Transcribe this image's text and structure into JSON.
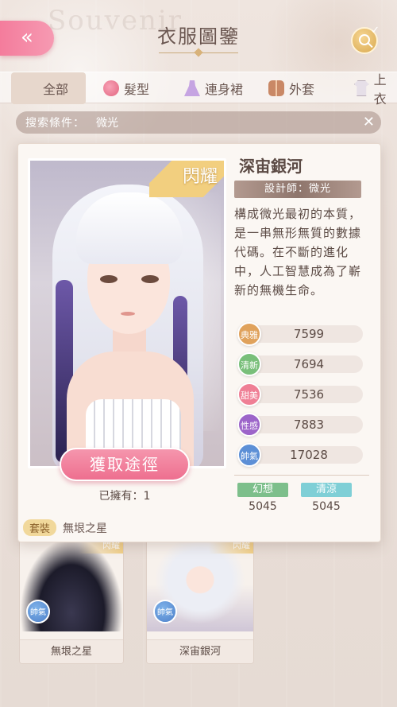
{
  "header": {
    "title": "衣服圖鑒",
    "back_icon": "«",
    "bg_text": "Souvenir"
  },
  "tabs": [
    {
      "label": "全部",
      "icon": "grid-icon",
      "active": true
    },
    {
      "label": "髮型",
      "icon": "hair-icon"
    },
    {
      "label": "連身裙",
      "icon": "dress-icon"
    },
    {
      "label": "外套",
      "icon": "coat-icon"
    },
    {
      "label": "上衣",
      "icon": "top-icon"
    }
  ],
  "filter": {
    "label": "搜索條件：",
    "value": "微光",
    "clear": "✕"
  },
  "detail": {
    "badge": "閃耀",
    "name": "深宙銀河",
    "designer": "設計師：微光",
    "description": "構成微光最初的本質，是一串無形無質的數據代碼。在不斷的進化中，人工智慧成為了嶄新的無機生命。",
    "obtain_button": "獲取途徑",
    "owned": "已擁有：1",
    "set_tag": "套裝",
    "set_name": "無垠之星",
    "stats": [
      {
        "label": "典雅",
        "value": "7599",
        "color": "#e0a25c"
      },
      {
        "label": "清新",
        "value": "7694",
        "color": "#79bf7a"
      },
      {
        "label": "甜美",
        "value": "7536",
        "color": "#ef7f95"
      },
      {
        "label": "性感",
        "value": "7883",
        "color": "#9c64c9"
      },
      {
        "label": "帥氣",
        "value": "17028",
        "color": "#5c8fd6"
      }
    ],
    "style_tags": [
      {
        "label": "幻想",
        "value": "5045",
        "color": "#7dbf8b"
      },
      {
        "label": "清涼",
        "value": "5045",
        "color": "#7fcfd6"
      }
    ]
  },
  "cards": [
    {
      "name": "無垠之星",
      "stat": "帥氣"
    },
    {
      "name": "深宙銀河",
      "stat": "帥氣"
    }
  ]
}
